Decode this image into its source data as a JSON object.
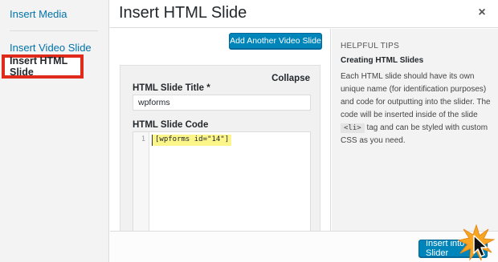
{
  "sidebar": {
    "items": [
      {
        "label": "Insert Media"
      },
      {
        "label": "Insert Video Slide"
      },
      {
        "label": "Insert HTML Slide"
      }
    ]
  },
  "header": {
    "title": "Insert HTML Slide",
    "close_symbol": "×"
  },
  "main": {
    "add_video_label": "Add Another Video Slide",
    "collapse_label": "Collapse",
    "title_field_label": "HTML Slide Title *",
    "title_value": "wpforms",
    "code_field_label": "HTML Slide Code",
    "code_line_number": "1",
    "code_text": "[wpforms id=\"14\"]"
  },
  "tips": {
    "heading": "HELPFUL TIPS",
    "subheading": "Creating HTML Slides",
    "body_before": "Each HTML slide should have its own unique name (for identification purposes) and code for outputting into the slider. The code will be inserted inside of the slide ",
    "code_tag": "<li>",
    "body_after": " tag and can be styled with custom CSS as you need."
  },
  "footer": {
    "insert_label": "Insert into Slider"
  },
  "icons": {
    "close": "close-icon",
    "cursor": "pointer-cursor-icon",
    "highlight": "starburst-icon"
  },
  "colors": {
    "accent": "#0085ba",
    "highlight_border": "#e02a1c",
    "code_highlight": "#fbf58a",
    "starburst": "#f6a623"
  }
}
